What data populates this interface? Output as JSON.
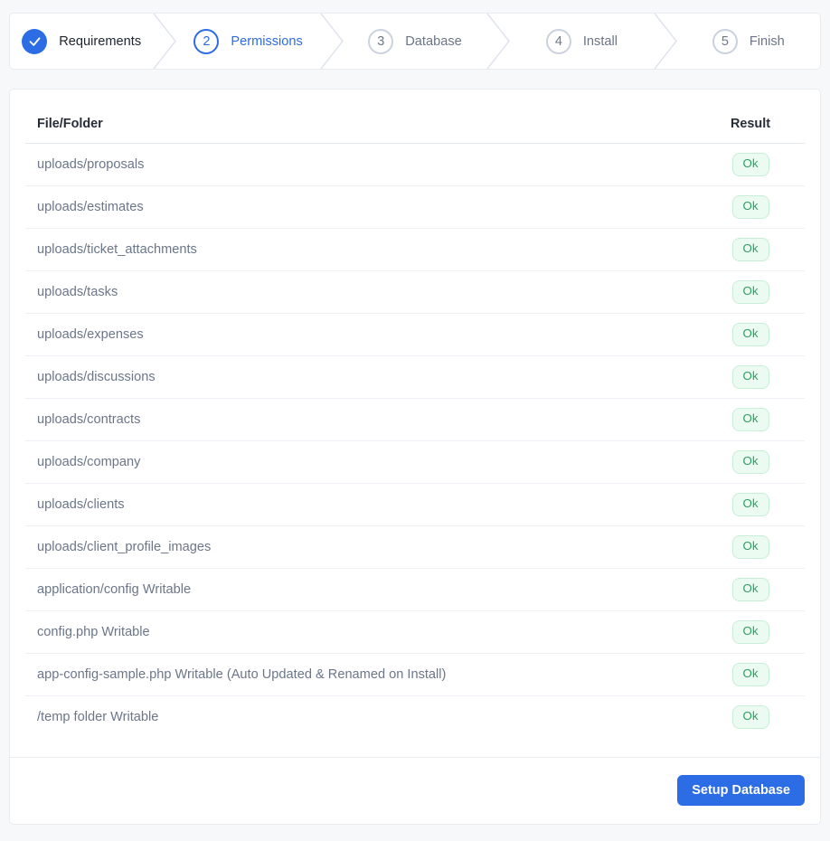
{
  "stepper": {
    "steps": [
      {
        "label": "Requirements",
        "state": "completed",
        "icon": "check-icon"
      },
      {
        "number": "2",
        "label": "Permissions",
        "state": "active"
      },
      {
        "number": "3",
        "label": "Database",
        "state": "upcoming"
      },
      {
        "number": "4",
        "label": "Install",
        "state": "upcoming"
      },
      {
        "number": "5",
        "label": "Finish",
        "state": "upcoming"
      }
    ]
  },
  "permissions": {
    "columns": [
      "File/Folder",
      "Result"
    ],
    "rows": [
      {
        "file": "uploads/proposals",
        "result": "Ok"
      },
      {
        "file": "uploads/estimates",
        "result": "Ok"
      },
      {
        "file": "uploads/ticket_attachments",
        "result": "Ok"
      },
      {
        "file": "uploads/tasks",
        "result": "Ok"
      },
      {
        "file": "uploads/expenses",
        "result": "Ok"
      },
      {
        "file": "uploads/discussions",
        "result": "Ok"
      },
      {
        "file": "uploads/contracts",
        "result": "Ok"
      },
      {
        "file": "uploads/company",
        "result": "Ok"
      },
      {
        "file": "uploads/clients",
        "result": "Ok"
      },
      {
        "file": "uploads/client_profile_images",
        "result": "Ok"
      },
      {
        "file": "application/config Writable",
        "result": "Ok"
      },
      {
        "file": "config.php Writable",
        "result": "Ok"
      },
      {
        "file": "app-config-sample.php Writable (Auto Updated & Renamed on Install)",
        "result": "Ok"
      },
      {
        "file": "/temp folder Writable",
        "result": "Ok"
      }
    ]
  },
  "footer": {
    "setup_database_label": "Setup Database"
  },
  "colors": {
    "primary": "#2c6ce4",
    "success_text": "#2f9e62",
    "success_bg": "#ebfbf1",
    "success_border": "#c7eed6",
    "step_inactive_border": "#cbd2df",
    "chevron": "#dce1eb"
  }
}
